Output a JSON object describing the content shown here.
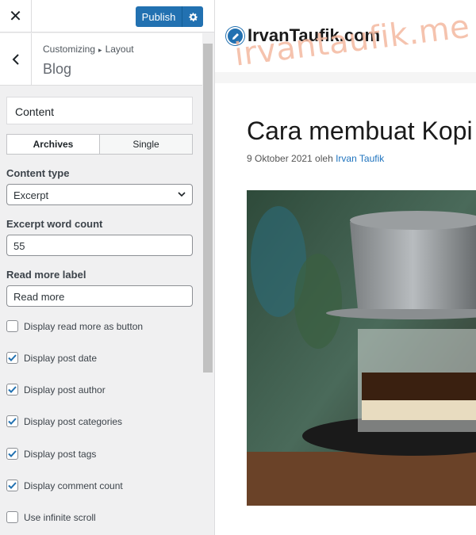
{
  "topbar": {
    "close_glyph": "✕",
    "publish_label": "Publish"
  },
  "header": {
    "crumb_root": "Customizing",
    "crumb_sep": "▸",
    "crumb_parent": "Layout",
    "title": "Blog"
  },
  "content_card": {
    "label": "Content"
  },
  "tabs": [
    {
      "label": "Archives",
      "active": true
    },
    {
      "label": "Single",
      "active": false
    }
  ],
  "fields": {
    "content_type": {
      "label": "Content type",
      "value": "Excerpt"
    },
    "excerpt_count": {
      "label": "Excerpt word count",
      "value": "55"
    },
    "read_more": {
      "label": "Read more label",
      "value": "Read more"
    }
  },
  "checkboxes": [
    {
      "label": "Display read more as button",
      "checked": false
    },
    {
      "label": "Display post date",
      "checked": true
    },
    {
      "label": "Display post author",
      "checked": true
    },
    {
      "label": "Display post categories",
      "checked": true
    },
    {
      "label": "Display post tags",
      "checked": true
    },
    {
      "label": "Display comment count",
      "checked": true
    },
    {
      "label": "Use infinite scroll",
      "checked": false
    }
  ],
  "preview": {
    "site_title": "IrvanTaufik.com",
    "watermark": "irvantaufik.me",
    "post_title": "Cara membuat Kopi",
    "meta_date": "9 Oktober 2021 oleh",
    "meta_author": "Irvan Taufik",
    "image_alt_icon": "coffee-photo"
  },
  "colors": {
    "accent": "#2271b1",
    "link": "#1e73be",
    "watermark": "#f4b9a0"
  }
}
